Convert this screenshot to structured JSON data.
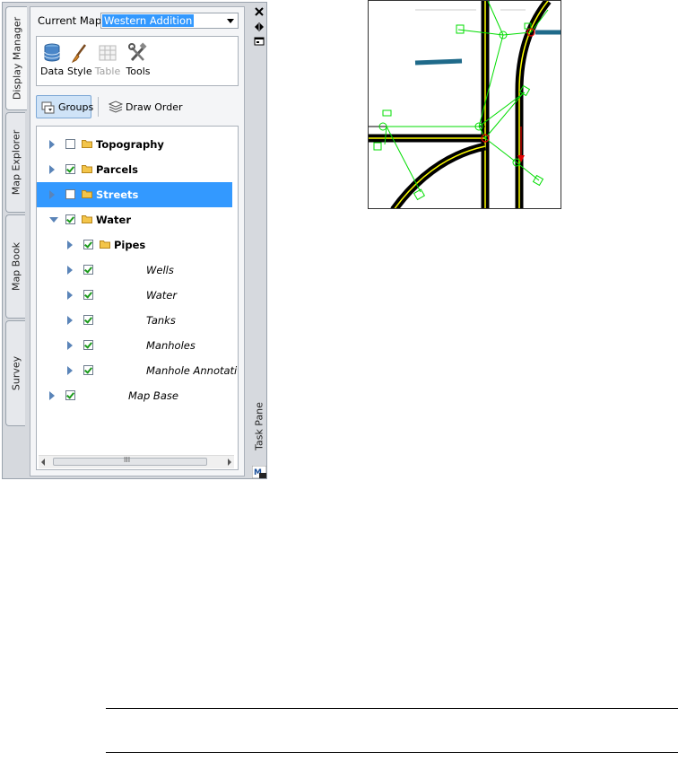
{
  "side_tabs": [
    {
      "label": "Display Manager",
      "active": true
    },
    {
      "label": "Map Explorer",
      "active": false
    },
    {
      "label": "Map Book",
      "active": false
    },
    {
      "label": "Survey",
      "active": false
    }
  ],
  "right_strip": {
    "task_pane_label": "Task Pane",
    "icons": [
      "close-icon",
      "auto-hide-icon",
      "properties-icon",
      "map-3d-icon"
    ]
  },
  "current_map": {
    "label": "Current Map:",
    "value": "Western Addition"
  },
  "toolbar": {
    "items": [
      {
        "label": "Data",
        "icon": "data-icon",
        "enabled": true
      },
      {
        "label": "Style",
        "icon": "style-brush-icon",
        "enabled": true
      },
      {
        "label": "Table",
        "icon": "table-icon",
        "enabled": false
      },
      {
        "label": "Tools",
        "icon": "tools-icon",
        "enabled": true
      }
    ]
  },
  "view_toggle": {
    "groups_label": "Groups",
    "draw_order_label": "Draw Order"
  },
  "tree": {
    "rows": [
      {
        "label": "Topography",
        "checked": false,
        "expanded": false,
        "folder": true,
        "selected": false
      },
      {
        "label": "Parcels",
        "checked": true,
        "expanded": false,
        "folder": true,
        "selected": false
      },
      {
        "label": "Streets",
        "checked": false,
        "expanded": false,
        "folder": true,
        "selected": true
      },
      {
        "label": "Water",
        "checked": true,
        "expanded": true,
        "folder": true,
        "selected": false
      },
      {
        "label": "Pipes",
        "checked": true,
        "expanded": false,
        "folder": true,
        "selected": false
      },
      {
        "label": "Wells",
        "checked": true,
        "expanded": false,
        "folder": false,
        "selected": false
      },
      {
        "label": "Water",
        "checked": true,
        "expanded": false,
        "folder": false,
        "selected": false
      },
      {
        "label": "Tanks",
        "checked": true,
        "expanded": false,
        "folder": false,
        "selected": false
      },
      {
        "label": "Manholes",
        "checked": true,
        "expanded": false,
        "folder": false,
        "selected": false
      },
      {
        "label": "Manhole Annotati",
        "checked": true,
        "expanded": false,
        "folder": false,
        "selected": false
      },
      {
        "label": "Map Base",
        "checked": true,
        "expanded": false,
        "folder": false,
        "selected": false
      }
    ],
    "scroll_thumb_glyph": "III"
  },
  "colors": {
    "selection": "#3399ff",
    "check": "#1a9a1a",
    "map_features": "#00dd00",
    "map_roads": "#000000",
    "map_road_center": "#ffff00",
    "map_water_line": "#1f6a8a",
    "map_arrow": "#e00000"
  }
}
